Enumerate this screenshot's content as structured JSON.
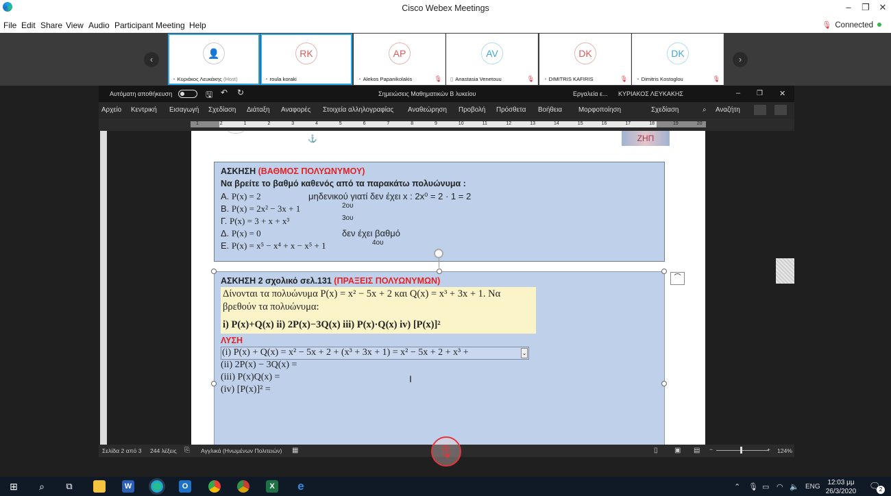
{
  "app": {
    "title": "Cisco Webex Meetings",
    "connection_status": "Connected",
    "menu": [
      "File",
      "Edit",
      "Share",
      "View",
      "Audio",
      "Participant",
      "Meeting",
      "Help"
    ]
  },
  "participants": [
    {
      "initials": "",
      "name": "Κυριάκος Λευκάκης",
      "role": "(Host)"
    },
    {
      "initials": "RK",
      "name": "roula koraki",
      "role": ""
    },
    {
      "initials": "AP",
      "name": "Alekos Papanikolakis",
      "role": ""
    },
    {
      "initials": "AV",
      "name": "Anastasia Venetouu",
      "role": ""
    },
    {
      "initials": "DK",
      "name": "DIMITRIS KAFIRIS",
      "role": ""
    },
    {
      "initials": "DK",
      "name": "Dimitris Kostoglou",
      "role": ""
    }
  ],
  "word": {
    "autosave_label": "Αυτόματη αποθήκευση",
    "document_title": "Σημειώσεις Μαθηματικών Β λυκείου",
    "tools_label": "Εργαλεία ε...",
    "user_name": "ΚΥΡΙΑΚΟΣ ΛΕΥΚΑΚΗΣ",
    "ribbon_tabs": [
      "Αρχείο",
      "Κεντρική",
      "Εισαγωγή",
      "Σχεδίαση",
      "Διάταξη",
      "Αναφορές",
      "Στοιχεία αλληλογραφίας",
      "Αναθεώρηση",
      "Προβολή",
      "Πρόσθετα",
      "Βοήθεια",
      "Μορφοποίηση",
      "Σχεδίαση"
    ],
    "search_label": "Αναζήτη",
    "ruler_numbers": [
      "1",
      "2",
      "1",
      "2",
      "3",
      "4",
      "5",
      "6",
      "7",
      "8",
      "9",
      "10",
      "11",
      "12",
      "13",
      "14",
      "15",
      "16",
      "17",
      "18",
      "19",
      "20"
    ],
    "status": {
      "page": "Σελίδα 2 από 3",
      "words": "244 λέξεις",
      "language": "Αγγλικά (Ηνωμένων Πολιτειών)",
      "zoom": "124%"
    }
  },
  "exercise1": {
    "heading": "ΑΣΚΗΣΗ",
    "heading_red": "(ΒΑΘΜΟΣ ΠΟΛΥΩΝΥΜΟΥ)",
    "instruction": "Να βρείτε το βαθμό καθενός από τα παρακάτω πολυώνυμα :",
    "rows": [
      {
        "label": "Α.",
        "expr": "P(x) = 2",
        "answer": "μηδενικού γιατί δεν έχει x : 2x⁰ = 2 · 1 = 2"
      },
      {
        "label": "Β.",
        "expr": "P(x) = 2x² − 3x + 1",
        "answer": "2ου"
      },
      {
        "label": "Γ.",
        "expr": "P(x) = 3 + x + x³",
        "answer": "3ου"
      },
      {
        "label": "Δ.",
        "expr": "P(x) = 0",
        "answer": "δεν έχει βαθμό"
      },
      {
        "label": "Ε.",
        "expr": "P(x) = x⁵ − x⁴ + x − x⁵ + 1",
        "answer": "4ου"
      }
    ]
  },
  "exercise2": {
    "heading": "ΑΣΚΗΣΗ 2 σχολικό σελ.131",
    "heading_red": "(ΠΡΑΞΕΙΣ ΠΟΛΥΩΝΥΜΩΝ)",
    "given_line1": "Δίνονται τα πολυώνυμα  P(x) = x² − 5x + 2  και  Q(x) = x³ + 3x + 1.  Να",
    "given_line2": "βρεθούν τα πολυώνυμα:",
    "tasks": "i) P(x)+Q(x)     ii) 2P(x)−3Q(x)      iii) P(x)·Q(x)    iv) [P(x)]²",
    "solution_label": "ΛΥΣΗ",
    "solution_lines": [
      "(i) P(x) + Q(x) = x² − 5x + 2 + (x³ + 3x + 1) = x² − 5x + 2 + x³ +",
      "(ii) 2P(x) − 3Q(x) =",
      "(iii) P(x)Q(x) =",
      "(iv) [P(x)]² ="
    ]
  },
  "page_stamp": "ΖΗΠ",
  "taskbar": {
    "time": "12:03 μμ",
    "date": "26/3/2020",
    "language": "ENG",
    "notifications": "2"
  }
}
